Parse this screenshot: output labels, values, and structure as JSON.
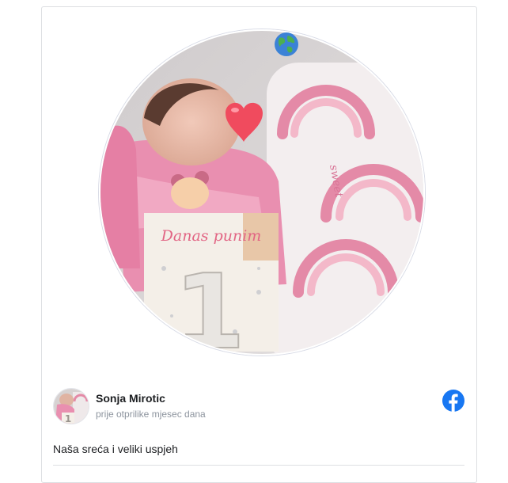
{
  "post": {
    "photo_caption": "Danas punim",
    "photo_number": "1",
    "author": "Sonja Mirotic",
    "timestamp": "prije otprilike mjesec dana",
    "text": "Naša sreća i veliki uspjeh"
  },
  "icons": {
    "globe": "globe-icon",
    "facebook": "facebook-logo-icon",
    "heart": "heart-emoji-icon"
  },
  "colors": {
    "facebook_blue": "#1877f2",
    "card_border": "#dddfe2",
    "secondary_text": "#8d949e",
    "primary_text": "#1c1e21",
    "pink": "#ea87a8"
  }
}
